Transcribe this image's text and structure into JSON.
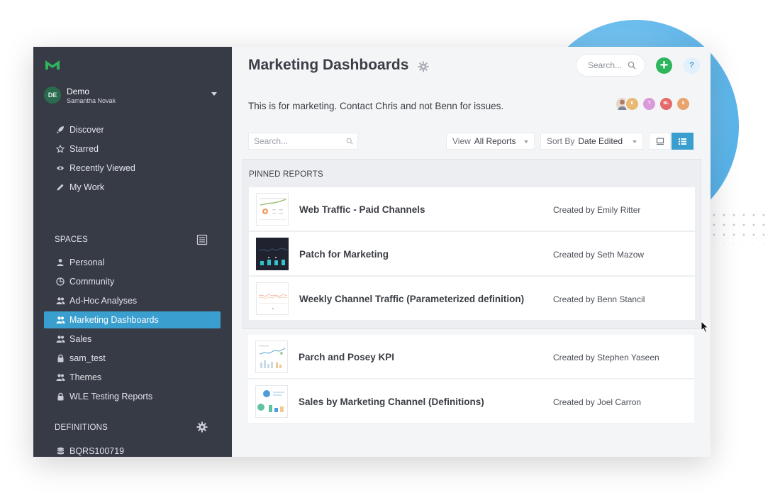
{
  "colors": {
    "sidebar_bg": "#373b46",
    "active_item": "#3a9fcf",
    "add_button": "#2fb55d",
    "brand_logo": "#2fb55d"
  },
  "sidebar": {
    "org": {
      "avatar_initials": "DE",
      "name": "Demo",
      "user": "Samantha Novak"
    },
    "primary_nav": [
      {
        "label": "Discover",
        "icon": "rocket-icon"
      },
      {
        "label": "Starred",
        "icon": "star-icon"
      },
      {
        "label": "Recently Viewed",
        "icon": "eye-icon"
      },
      {
        "label": "My Work",
        "icon": "pencil-icon"
      }
    ],
    "spaces_title": "SPACES",
    "spaces": [
      {
        "label": "Personal",
        "icon": "user-icon"
      },
      {
        "label": "Community",
        "icon": "globe-icon"
      },
      {
        "label": "Ad-Hoc Analyses",
        "icon": "users-icon"
      },
      {
        "label": "Marketing Dashboards",
        "icon": "users-icon",
        "active": true
      },
      {
        "label": "Sales",
        "icon": "users-icon"
      },
      {
        "label": "sam_test",
        "icon": "lock-icon"
      },
      {
        "label": "Themes",
        "icon": "users-icon"
      },
      {
        "label": "WLE Testing Reports",
        "icon": "lock-icon"
      }
    ],
    "definitions_title": "DEFINITIONS",
    "definitions": [
      {
        "label": "BQRS100719",
        "icon": "database-icon"
      }
    ]
  },
  "main": {
    "title": "Marketing Dashboards",
    "search_placeholder": "Search...",
    "help_label": "?",
    "add_label": "+",
    "description": "This is for marketing. Contact Chris and not Benn for issues.",
    "members": [
      {
        "initials": "",
        "color": "#c9a38a"
      },
      {
        "initials": "E",
        "color": "#e9b872"
      },
      {
        "initials": "T",
        "color": "#d89ad8"
      },
      {
        "initials": "BL",
        "color": "#e46a6a"
      },
      {
        "initials": "S",
        "color": "#e8a46c"
      }
    ],
    "list_search_placeholder": "Search...",
    "view_filter": {
      "label": "View",
      "value": "All Reports"
    },
    "sort": {
      "label": "Sort By",
      "value": "Date Edited"
    },
    "pinned_title": "PINNED REPORTS",
    "pinned_reports": [
      {
        "name": "Web Traffic - Paid Channels",
        "created_by": "Created by Emily Ritter"
      },
      {
        "name": "Patch for Marketing",
        "created_by": "Created by Seth Mazow"
      },
      {
        "name": "Weekly Channel Traffic (Parameterized definition)",
        "created_by": "Created by Benn Stancil"
      }
    ],
    "other_reports": [
      {
        "name": "Parch and Posey KPI",
        "created_by": "Created by Stephen Yaseen"
      },
      {
        "name": "Sales by Marketing Channel (Definitions)",
        "created_by": "Created by Joel Carron"
      }
    ]
  }
}
